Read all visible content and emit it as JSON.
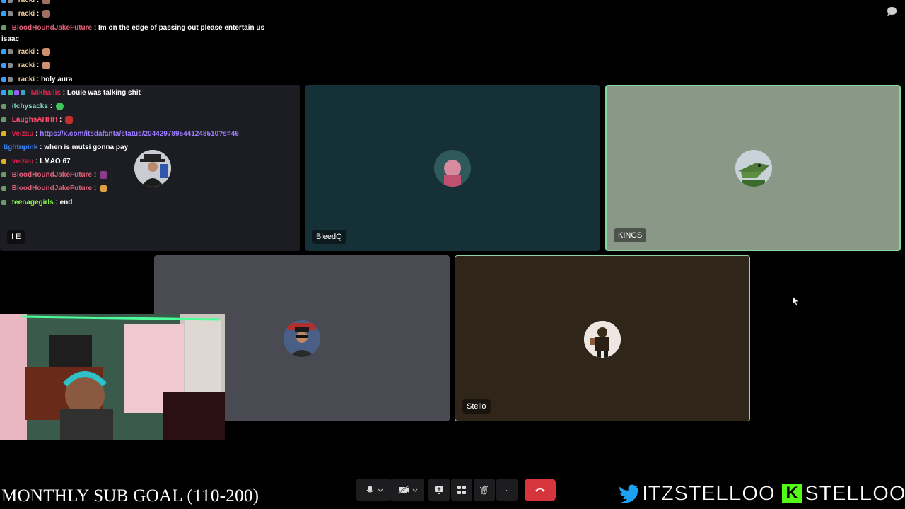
{
  "chat": {
    "messages": [
      {
        "user": "racki",
        "text": "",
        "user_color": "#e8c896",
        "emote": "#a07060"
      },
      {
        "user": "racki",
        "text": "",
        "user_color": "#e8c896",
        "emote": "#a07060"
      },
      {
        "user": "BloodHoundJakeFuture",
        "text": "Im on the edge of passing out please entertain us",
        "user_color": "#e0607a"
      },
      {
        "user": "",
        "text": "isaac",
        "user_color": "#fff"
      },
      {
        "user": "racki",
        "text": "",
        "user_color": "#e8c896",
        "emote": "#d09070"
      },
      {
        "user": "racki",
        "text": "",
        "user_color": "#e8c896",
        "emote": "#d09070"
      },
      {
        "user": "racki",
        "text": "holy aura",
        "user_color": "#e8c896"
      },
      {
        "user": "Mikhailis",
        "text": "Louie was talking shit",
        "user_color": "#d8264a"
      },
      {
        "user": "itchysacks",
        "text": "",
        "user_color": "#7fd4c8",
        "emote": "#3cc85a"
      },
      {
        "user": "LaughsAHHH",
        "text": "",
        "user_color": "#ff4d6a",
        "emote": "#c03030"
      },
      {
        "user": "veizau",
        "text": "https://x.com/itsdafanta/status/2044297895441248510?s=46",
        "user_color": "#d8264a",
        "text_color": "#9b7cff"
      },
      {
        "user": "tightnpink",
        "text": "when is mutsi gonna pay",
        "user_color": "#3b82f6"
      },
      {
        "user": "veizau",
        "text": "LMAO 67",
        "user_color": "#d8264a"
      },
      {
        "user": "BloodHoundJakeFuture",
        "text": "",
        "user_color": "#e0607a",
        "emote": "#8a3c88"
      },
      {
        "user": "BloodHoundJakeFuture",
        "text": "",
        "user_color": "#e0607a",
        "emote": "#e0a040"
      },
      {
        "user": "teenagegirls",
        "text": "end",
        "user_color": "#8aff4a"
      }
    ]
  },
  "participants": [
    {
      "name": "! E"
    },
    {
      "name": "BleedQ"
    },
    {
      "name": "KINGS"
    },
    {
      "name": ""
    },
    {
      "name": "Stello"
    }
  ],
  "controls": {
    "mic_icon": "microphone-icon",
    "camera_icon": "camera-off-icon",
    "share_icon": "screen-share-icon",
    "apps_icon": "grid-icon",
    "reactions_icon": "reactions-icon",
    "more_label": "···"
  },
  "overlay": {
    "sub_goal": "MONTHLY SUB GOAL (110-200)",
    "twitter_handle": "ITZSTELLOO",
    "kick_handle": "STELLOOO"
  },
  "colors": {
    "hangup": "#d6353e",
    "active_speaker": "#85d89c",
    "kick_green": "#53fc18"
  }
}
